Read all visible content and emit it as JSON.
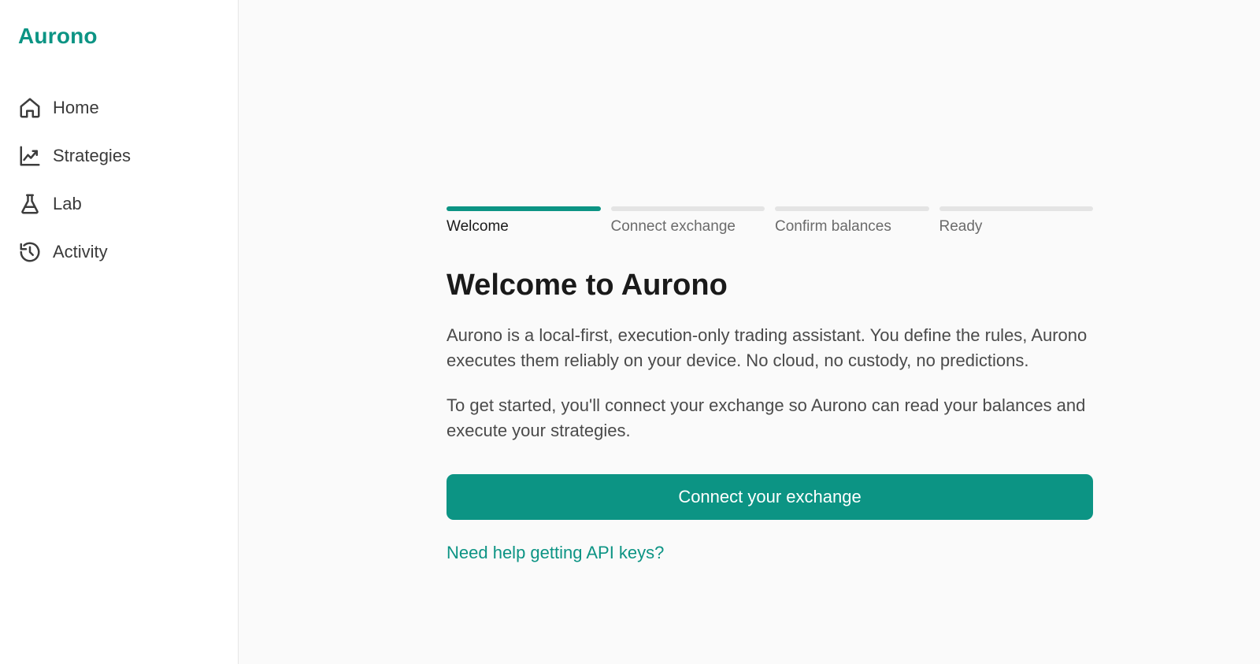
{
  "app": {
    "name": "Aurono",
    "accent_color": "#0c9484"
  },
  "sidebar": {
    "items": [
      {
        "label": "Home",
        "icon": "home-icon"
      },
      {
        "label": "Strategies",
        "icon": "chart-line-icon"
      },
      {
        "label": "Lab",
        "icon": "flask-icon"
      },
      {
        "label": "Activity",
        "icon": "history-icon"
      }
    ]
  },
  "onboarding": {
    "steps": [
      {
        "label": "Welcome",
        "active": true
      },
      {
        "label": "Connect exchange",
        "active": false
      },
      {
        "label": "Confirm balances",
        "active": false
      },
      {
        "label": "Ready",
        "active": false
      }
    ],
    "title": "Welcome to Aurono",
    "paragraph_1": "Aurono is a local-first, execution-only trading assistant. You define the rules, Aurono executes them reliably on your device. No cloud, no custody, no predictions.",
    "paragraph_2": "To get started, you'll connect your exchange so Aurono can read your balances and execute your strategies.",
    "cta_label": "Connect your exchange",
    "help_link_label": "Need help getting API keys?"
  }
}
